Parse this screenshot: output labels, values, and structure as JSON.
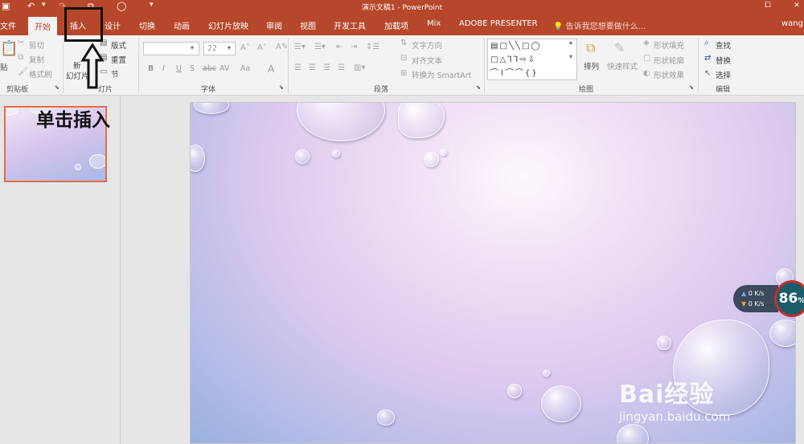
{
  "window": {
    "title": "演示文稿1 - PowerPoint",
    "quick_access": {
      "save_icon": "save-icon",
      "undo_icon": "undo-icon",
      "redo_icon": "redo-icon",
      "customize": "▾"
    },
    "controls": {
      "close": "✕"
    }
  },
  "tabs": [
    "文件",
    "开始",
    "插入",
    "设计",
    "切换",
    "动画",
    "幻灯片放映",
    "审阅",
    "视图",
    "开发工具",
    "加载项",
    "Mix",
    "ADOBE PRESENTER"
  ],
  "active_tab": "开始",
  "highlighted_tab": "插入",
  "tell_me": "告诉我您想要做什么...",
  "user": "wang",
  "ribbon": {
    "clipboard": {
      "label": "剪贴板",
      "paste": "贴",
      "cut": "剪切",
      "copy": "复制",
      "format_painter": "格式刷"
    },
    "slides": {
      "label": "灯片",
      "new_slide": "新",
      "new_slide_sub": "幻灯片",
      "layout": "版式",
      "reset": "重置",
      "section": "节"
    },
    "font": {
      "label": "字体",
      "font_name": "",
      "font_size": "22",
      "bold": "B",
      "italic": "I",
      "underline": "U",
      "shadow": "S",
      "strike": "abc",
      "spacing": "AV",
      "case": "Aa",
      "color": "A"
    },
    "paragraph": {
      "label": "段落",
      "text_direction": "文字方向",
      "align_text": "对齐文本",
      "convert_smartart": "转换为 SmartArt"
    },
    "drawing": {
      "label": "绘图",
      "arrange": "排列",
      "quick_styles": "快速样式",
      "shape_fill": "形状填充",
      "shape_outline": "形状轮廓",
      "shape_effects": "形状效果"
    },
    "editing": {
      "label": "编辑",
      "find": "查找",
      "replace": "替换",
      "select": "选择"
    }
  },
  "annotation": {
    "text": "单击插入",
    "arrow_icon": "up-arrow-icon"
  },
  "speed_widget": {
    "up": "0 K/s",
    "down": "0 K/s",
    "percent": "86",
    "percent_unit": "%"
  },
  "watermark": {
    "brand": "Bai经验",
    "url": "jingyan.baidu.com"
  },
  "colors": {
    "accent": "#b7472a",
    "ribbon_bg": "#f3f3f3",
    "annotation": "#111111",
    "thumbnail_border": "#e46c4a"
  }
}
